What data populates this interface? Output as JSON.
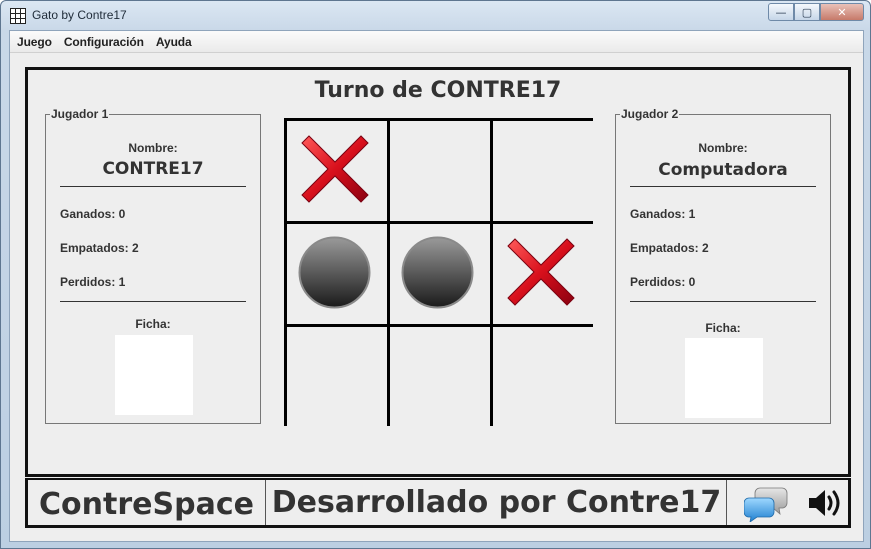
{
  "window": {
    "title": "Gato by Contre17",
    "controls": {
      "minimize": "—",
      "maximize": "▢",
      "close": "✕"
    }
  },
  "menu": [
    "Juego",
    "Configuración",
    "Ayuda"
  ],
  "game": {
    "turn_text": "Turno de CONTRE17",
    "board": [
      [
        "X",
        "",
        ""
      ],
      [
        "O",
        "O",
        "X"
      ],
      [
        "",
        "",
        ""
      ]
    ]
  },
  "player1": {
    "legend": "Jugador 1",
    "name_label": "Nombre:",
    "name": "CONTRE17",
    "wins": "Ganados: 0",
    "ties": "Empatados: 2",
    "losses": "Perdidos: 1",
    "chip_label": "Ficha:"
  },
  "player2": {
    "legend": "Jugador 2",
    "name_label": "Nombre:",
    "name": "Computadora",
    "wins": "Ganados: 1",
    "ties": "Empatados: 2",
    "losses": "Perdidos: 0",
    "chip_label": "Ficha:"
  },
  "footer": {
    "brand": "ContreSpace",
    "credit": "Desarrollado por Contre17",
    "icons": [
      "chat-icon",
      "speaker-icon"
    ]
  },
  "colors": {
    "x_mark": "#d8101c",
    "o_mark": "#5a5a5a",
    "panel_bg": "#eeeeee"
  }
}
